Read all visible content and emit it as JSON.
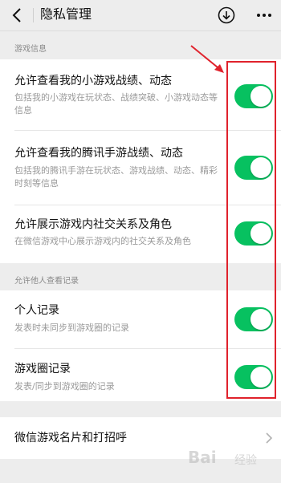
{
  "header": {
    "title": "隐私管理",
    "back_icon": "chevron-left-icon",
    "download_icon": "download-circle-icon",
    "more_icon": "more-dots-icon"
  },
  "sections": [
    {
      "label": "游戏信息",
      "items": [
        {
          "title": "允许查看我的小游戏战绩、动态",
          "desc": "包括我的小游戏在玩状态、战绩突破、小游戏动态等信息",
          "enabled": true
        },
        {
          "title": "允许查看我的腾讯手游战绩、动态",
          "desc": "包括我的腾讯手游在玩状态、游戏战绩、动态、精彩时刻等信息",
          "enabled": true
        },
        {
          "title": "允许展示游戏内社交关系及角色",
          "desc": "在微信游戏中心展示游戏内的社交关系及角色",
          "enabled": true
        }
      ]
    },
    {
      "label": "允许他人查看记录",
      "items": [
        {
          "title": "个人记录",
          "desc": "发表时未同步到游戏圈的记录",
          "enabled": true
        },
        {
          "title": "游戏圈记录",
          "desc": "发表/同步到游戏圈的记录",
          "enabled": true
        }
      ]
    }
  ],
  "link_row": {
    "title": "微信游戏名片和打招呼"
  },
  "colors": {
    "toggle_on": "#07c160",
    "annotation": "#e0222c",
    "background": "#ededed"
  },
  "watermark": {
    "text": "Bai",
    "sub": "经验"
  }
}
